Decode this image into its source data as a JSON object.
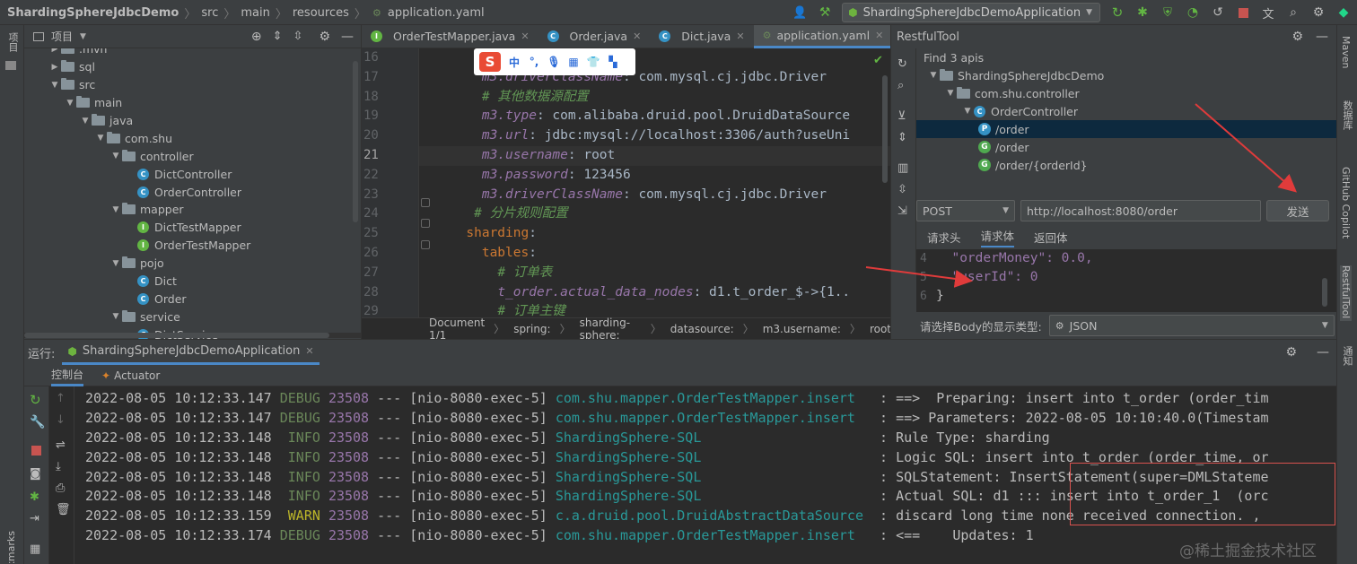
{
  "topbar": {
    "breadcrumb": [
      "ShardingSphereJdbcDemo",
      "src",
      "main",
      "resources",
      "application.yaml"
    ],
    "run_config": "ShardingSphereJdbcDemoApplication"
  },
  "left_strip": {
    "project_label": "项目",
    "bookmarks_label": "Bookmarks"
  },
  "project_panel": {
    "title": "项目",
    "tree": [
      {
        "label": ".mvn",
        "kind": "folder",
        "depth": 1,
        "expanded": false
      },
      {
        "label": "sql",
        "kind": "folder",
        "depth": 1,
        "expanded": false
      },
      {
        "label": "src",
        "kind": "folder",
        "depth": 1,
        "expanded": true
      },
      {
        "label": "main",
        "kind": "folder",
        "depth": 2,
        "expanded": true
      },
      {
        "label": "java",
        "kind": "folder",
        "depth": 3,
        "expanded": true
      },
      {
        "label": "com.shu",
        "kind": "folder",
        "depth": 4,
        "expanded": true
      },
      {
        "label": "controller",
        "kind": "folder",
        "depth": 5,
        "expanded": true
      },
      {
        "label": "DictController",
        "kind": "class",
        "depth": 6
      },
      {
        "label": "OrderController",
        "kind": "class",
        "depth": 6
      },
      {
        "label": "mapper",
        "kind": "folder",
        "depth": 5,
        "expanded": true
      },
      {
        "label": "DictTestMapper",
        "kind": "interface",
        "depth": 6
      },
      {
        "label": "OrderTestMapper",
        "kind": "interface",
        "depth": 6
      },
      {
        "label": "pojo",
        "kind": "folder",
        "depth": 5,
        "expanded": true
      },
      {
        "label": "Dict",
        "kind": "class",
        "depth": 6
      },
      {
        "label": "Order",
        "kind": "class",
        "depth": 6
      },
      {
        "label": "service",
        "kind": "folder",
        "depth": 5,
        "expanded": true
      },
      {
        "label": "DictService",
        "kind": "class",
        "depth": 6
      }
    ]
  },
  "editor": {
    "tabs": [
      {
        "label": "OrderTestMapper.java",
        "active": false
      },
      {
        "label": "Order.java",
        "active": false
      },
      {
        "label": "Dict.java",
        "active": false
      },
      {
        "label": "application.yaml",
        "active": true
      }
    ],
    "line_numbers": [
      "16",
      "17",
      "18",
      "19",
      "20",
      "21",
      "22",
      "23",
      "24",
      "25",
      "26",
      "27",
      "28",
      "29"
    ],
    "current_line": "21",
    "status": [
      "Document 1/1",
      "spring:",
      "sharding-sphere:",
      "datasource:",
      "m3.username:",
      "root"
    ]
  },
  "restful": {
    "title": "RestfulTool",
    "summary": "Find 3 apis",
    "tree": [
      {
        "label": "ShardingSphereJdbcDemo",
        "kind": "module",
        "depth": 0
      },
      {
        "label": "com.shu.controller",
        "kind": "package",
        "depth": 1
      },
      {
        "label": "OrderController",
        "kind": "class",
        "depth": 2
      },
      {
        "label": "/order",
        "kind": "api",
        "method": "P",
        "depth": 3,
        "selected": true
      },
      {
        "label": "/order",
        "kind": "api",
        "method": "G",
        "depth": 3
      },
      {
        "label": "/order/{orderId}",
        "kind": "api",
        "method": "G",
        "depth": 3
      }
    ],
    "method": "POST",
    "url": "http://localhost:8080/order",
    "send": "发送",
    "tabs": [
      "请求头",
      "请求体",
      "返回体"
    ],
    "active_tab": "请求体",
    "body_lines": [
      {
        "n": "4",
        "text": "\"orderMoney\": 0.0,"
      },
      {
        "n": "5",
        "text": "\"userId\": 0"
      },
      {
        "n": "6",
        "text": "}"
      }
    ],
    "body_type_label": "请选择Body的显示类型:",
    "body_type": "JSON"
  },
  "right_strip": {
    "labels": [
      "Maven",
      "数据库",
      "GitHub Copilot",
      "RestfulTool",
      "通知"
    ]
  },
  "run": {
    "label": "运行:",
    "config": "ShardingSphereJdbcDemoApplication",
    "tabs": [
      "控制台",
      "Actuator"
    ],
    "log": [
      {
        "ts": "2022-08-05 10:12:33.147",
        "level": "DEBUG",
        "pid": "23508",
        "thread": "[nio-8080-exec-5]",
        "logger": "com.shu.mapper.OrderTestMapper.insert  ",
        "msg": ": ==>  Preparing: insert into t_order (order_tim"
      },
      {
        "ts": "2022-08-05 10:12:33.147",
        "level": "DEBUG",
        "pid": "23508",
        "thread": "[nio-8080-exec-5]",
        "logger": "com.shu.mapper.OrderTestMapper.insert  ",
        "msg": ": ==> Parameters: 2022-08-05 10:10:40.0(Timestam"
      },
      {
        "ts": "2022-08-05 10:12:33.148",
        "level": " INFO",
        "pid": "23508",
        "thread": "[nio-8080-exec-5]",
        "logger": "ShardingSphere-SQL                     ",
        "msg": ": Rule Type: sharding"
      },
      {
        "ts": "2022-08-05 10:12:33.148",
        "level": " INFO",
        "pid": "23508",
        "thread": "[nio-8080-exec-5]",
        "logger": "ShardingSphere-SQL                     ",
        "msg": ": Logic SQL: insert into t_order (order_time, or"
      },
      {
        "ts": "2022-08-05 10:12:33.148",
        "level": " INFO",
        "pid": "23508",
        "thread": "[nio-8080-exec-5]",
        "logger": "ShardingSphere-SQL                     ",
        "msg": ": SQLStatement: InsertStatement(super=DMLStateme"
      },
      {
        "ts": "2022-08-05 10:12:33.148",
        "level": " INFO",
        "pid": "23508",
        "thread": "[nio-8080-exec-5]",
        "logger": "ShardingSphere-SQL                     ",
        "msg": ": Actual SQL: d1 ::: insert into t_order_1  (orc"
      },
      {
        "ts": "2022-08-05 10:12:33.159",
        "level": " WARN",
        "pid": "23508",
        "thread": "[nio-8080-exec-5]",
        "logger": "c.a.druid.pool.DruidAbstractDataSource ",
        "msg": ": discard long time none received connection. ,"
      },
      {
        "ts": "2022-08-05 10:12:33.174",
        "level": "DEBUG",
        "pid": "23508",
        "thread": "[nio-8080-exec-5]",
        "logger": "com.shu.mapper.OrderTestMapper.insert  ",
        "msg": ": <==    Updates: 1"
      }
    ]
  },
  "watermark": "@稀土掘金技术社区",
  "colors": {
    "accent": "#4a88c7",
    "arrow": "#e03b3b",
    "selected_row": "#0d293e"
  }
}
